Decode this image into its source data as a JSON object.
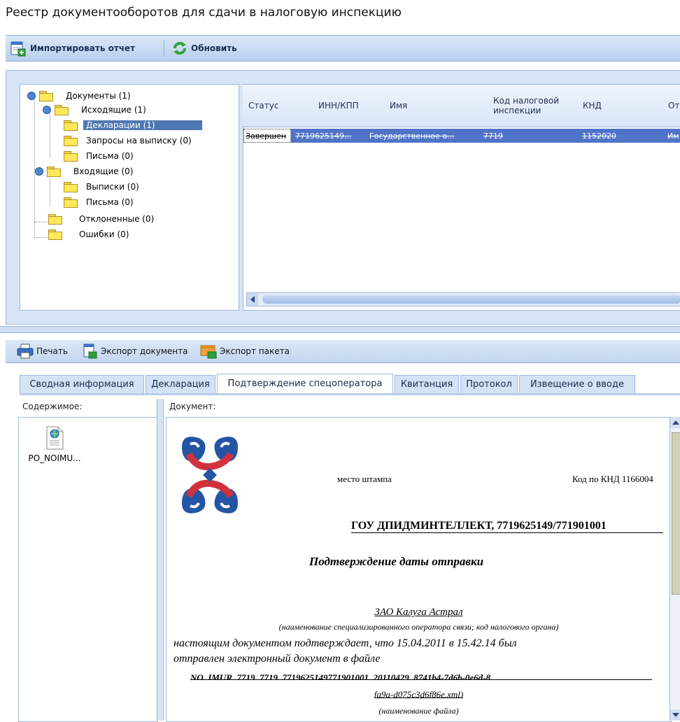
{
  "window": {
    "title": "Реестр документооборотов для сдачи в налоговую инспекцию"
  },
  "toolbar": {
    "import_label": "Импортировать отчет",
    "refresh_label": "Обновить"
  },
  "tree": {
    "root": "Документы (1)",
    "outgoing": "Исходящие (1)",
    "declarations": "Декларации (1)",
    "requests": "Запросы на выписку (0)",
    "letters_out": "Письма (0)",
    "incoming": "Входящие (0)",
    "statements": "Выписки (0)",
    "letters_in": "Письма (0)",
    "rejected": "Отклоненные (0)",
    "errors": "Ошибки (0)"
  },
  "grid": {
    "columns": [
      "Статус",
      "ИНН/КПП",
      "Имя",
      "Код налоговой инспекции",
      "КНД",
      "От"
    ],
    "rows": [
      {
        "status": "Завершен",
        "inn": "7719625149...",
        "name": "Государственное о...",
        "code": "7719",
        "knd": "1152020",
        "from": "Им"
      }
    ]
  },
  "toolbar2": {
    "print_label": "Печать",
    "export_doc_label": "Экспорт документа",
    "export_pkg_label": "Экспорт пакета"
  },
  "tabs": [
    "Сводная информация",
    "Декларация",
    "Подтверждение спецоператора",
    "Квитанция",
    "Протокол",
    "Извещение о вводе"
  ],
  "contents": {
    "label": "Содержимое:",
    "file_name": "PO_NOIMU..."
  },
  "document": {
    "label": "Документ:",
    "stamp_place": "место штампа",
    "knd_code": "Код по КНД 1166004",
    "recipient": "ГОУ ДПИДМИНТЕЛЛЕКТ, 7719625149/771901001",
    "heading": "Подтверждение даты отправки",
    "operator": "ЗАО Калуга Астрал",
    "operator_caption": "(наименование специализированного оператора связи; код налогового органа)",
    "body_line1": "настоящим документом подтверждает, что 15.04.2011 в 15.42.14 был",
    "body_line2": "отправлен электронный документ в файле",
    "file_line1": "NO_IMUR_7719_7719_7719625149771901001_20110429_8741b4-7d6b-0e6d-8",
    "file_line2": "fa9a-d075c3d6f86e.xml)",
    "file_caption": "(наименование файла)"
  },
  "colors": {
    "accent": "#4f73c8",
    "panel": "#d6e4f5",
    "selected": "#4f78b0"
  }
}
